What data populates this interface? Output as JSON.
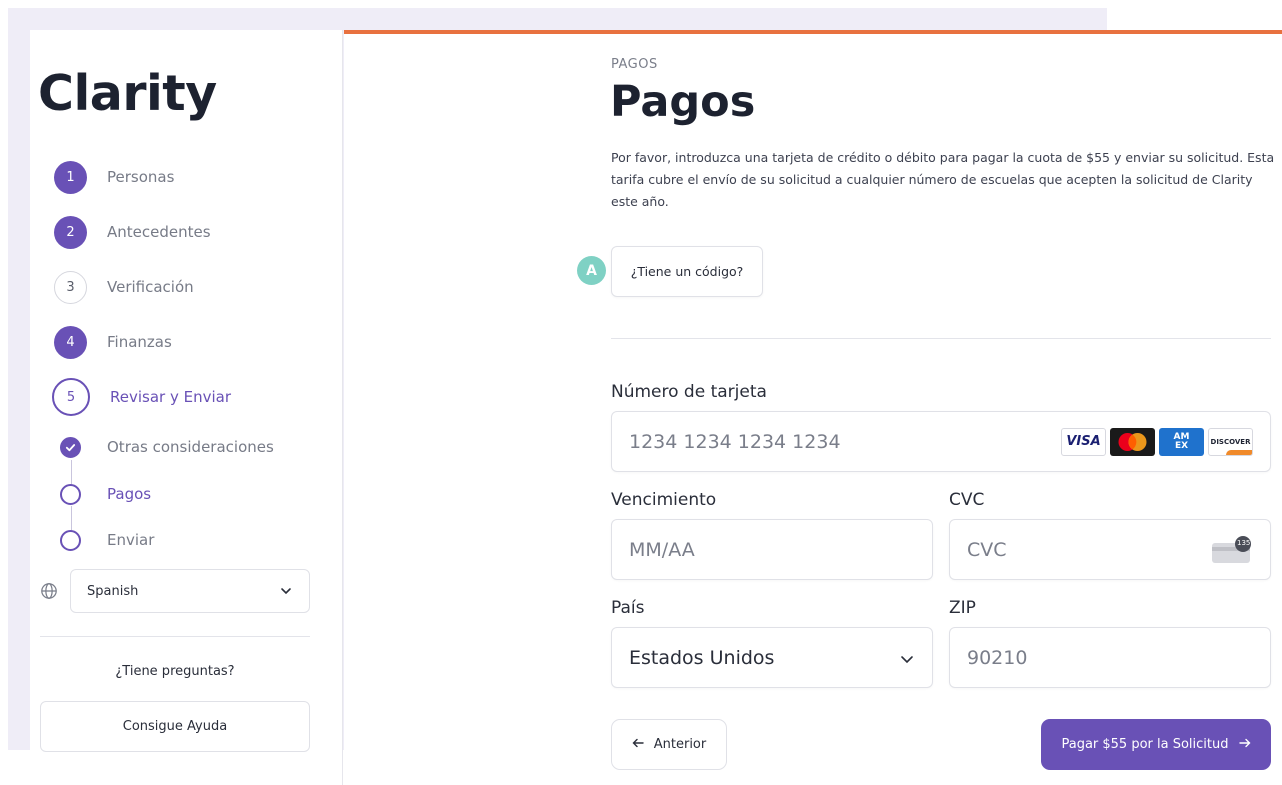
{
  "brand": "Clarity",
  "sidebar": {
    "steps": [
      {
        "num": "1",
        "label": "Personas"
      },
      {
        "num": "2",
        "label": "Antecedentes"
      },
      {
        "num": "3",
        "label": "Verificación"
      },
      {
        "num": "4",
        "label": "Finanzas"
      },
      {
        "num": "5",
        "label": "Revisar y Enviar"
      }
    ],
    "substeps": [
      {
        "label": "Otras consideraciones"
      },
      {
        "label": "Pagos"
      },
      {
        "label": "Enviar"
      }
    ],
    "language": "Spanish",
    "questions": "¿Tiene preguntas?",
    "help_label": "Consigue Ayuda"
  },
  "main": {
    "eyebrow": "PAGOS",
    "title": "Pagos",
    "description": "Por favor, introduzca una tarjeta de crédito o débito para pagar la cuota de $55 y enviar su solicitud. Esta tarifa cubre el envío de su solicitud a cualquier número de escuelas que acepten la solicitud de Clarity este año.",
    "code_button": "¿Tiene un código?",
    "marker": "A",
    "card_number": {
      "label": "Número de tarjeta",
      "placeholder": "1234 1234 1234 1234"
    },
    "card_brands": {
      "visa": "VISA",
      "amex_top": "AM",
      "amex_bottom": "EX",
      "discover": "DISCOVER"
    },
    "expiry": {
      "label": "Vencimiento",
      "placeholder": "MM/AA"
    },
    "cvc": {
      "label": "CVC",
      "placeholder": "CVC",
      "icon_text": "135"
    },
    "country": {
      "label": "País",
      "value": "Estados Unidos"
    },
    "zip": {
      "label": "ZIP",
      "value": "90210"
    },
    "prev_label": "Anterior",
    "pay_label": "Pagar $55 por la Solicitud"
  },
  "colors": {
    "accent": "#6951b6",
    "top_bar": "#e8713f",
    "marker": "#7fd1c4"
  }
}
